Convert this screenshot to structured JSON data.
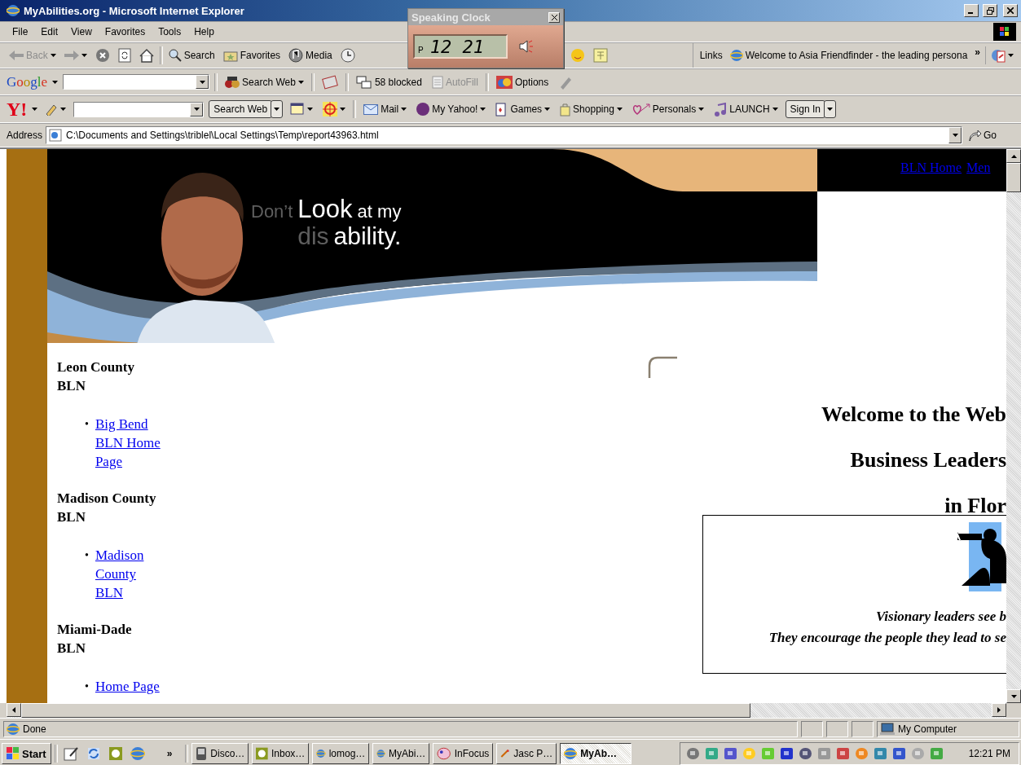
{
  "window": {
    "title": "MyAbilities.org - Microsoft Internet Explorer"
  },
  "menu": [
    "File",
    "Edit",
    "View",
    "Favorites",
    "Tools",
    "Help"
  ],
  "standard_toolbar": [
    {
      "label": "Back",
      "kind": "back",
      "disabled": true
    },
    {
      "label": "Search",
      "kind": "search",
      "disabled": false
    },
    {
      "label": "Favorites",
      "kind": "favorites",
      "disabled": false
    },
    {
      "label": "Media",
      "kind": "media",
      "disabled": false
    }
  ],
  "links_bar": {
    "label": "Links",
    "items": [
      "Welcome to Asia Friendfinder - the leading persona"
    ],
    "overflow": "»"
  },
  "google_toolbar": {
    "logo": "Google",
    "items": [
      {
        "label": "Search Web",
        "kind": "search",
        "disabled": false
      },
      {
        "label": "58 blocked",
        "kind": "popups",
        "disabled": false
      },
      {
        "label": "AutoFill",
        "kind": "autofill",
        "disabled": true
      },
      {
        "label": "Options",
        "kind": "options",
        "disabled": false
      }
    ]
  },
  "yahoo_toolbar": {
    "logo": "Y!",
    "search_button": "Search Web",
    "items": [
      {
        "label": "Mail",
        "kind": "mail"
      },
      {
        "label": "My Yahoo!",
        "kind": "myyahoo"
      },
      {
        "label": "Games",
        "kind": "games"
      },
      {
        "label": "Shopping",
        "kind": "shopping"
      },
      {
        "label": "Personals",
        "kind": "personals"
      },
      {
        "label": "LAUNCH",
        "kind": "launch"
      }
    ],
    "sign_in": "Sign In"
  },
  "address_bar": {
    "label": "Address",
    "value": "C:\\Documents and Settings\\triblel\\Local Settings\\Temp\\report43963.html",
    "go": "Go"
  },
  "speaking_clock": {
    "title": "Speaking Clock",
    "ampm": "P",
    "time": "12 21"
  },
  "page": {
    "top_links": [
      "BLN Home",
      "Men"
    ],
    "tagline": [
      [
        {
          "text": "Don’t",
          "kind": "dim"
        },
        {
          "text": "Look",
          "kind": "large"
        },
        {
          "text": "at my",
          "kind": "bright"
        }
      ],
      [
        {
          "text": "dis",
          "kind": "dim"
        },
        {
          "text": "ability.",
          "kind": "bright"
        }
      ]
    ],
    "counties": [
      {
        "name": "Leon County BLN",
        "links": [
          {
            "marker": "•",
            "text": "Big Bend BLN Home Page"
          }
        ]
      },
      {
        "name": "Madison County BLN",
        "links": [
          {
            "marker": "•",
            "text": "Madison County BLN"
          }
        ]
      },
      {
        "name": "Miami-Dade BLN",
        "links": [
          {
            "marker": "•",
            "text": "Home Page"
          }
        ]
      }
    ],
    "headings": [
      "Welcome to the Web",
      "Business Leaders",
      "in Flor"
    ],
    "quote": [
      "Visionary leaders see b",
      "They encourage the people they lead to se"
    ]
  },
  "status_bar": {
    "text": "Done",
    "zone": "My Computer"
  },
  "taskbar": {
    "start": "Start",
    "overflow": "»",
    "tasks": [
      {
        "label": "Disco…",
        "kind": "device",
        "selected": false
      },
      {
        "label": "Inbox…",
        "kind": "mail",
        "selected": false
      },
      {
        "label": "lomog…",
        "kind": "ie",
        "selected": false
      },
      {
        "label": "MyAbi…",
        "kind": "ie",
        "selected": false
      },
      {
        "label": "InFocus",
        "kind": "infocus",
        "selected": false
      },
      {
        "label": "Jasc P…",
        "kind": "jasc",
        "selected": false
      },
      {
        "label": "MyAb…",
        "kind": "ie",
        "selected": true
      }
    ],
    "clock": "12:21 PM"
  }
}
